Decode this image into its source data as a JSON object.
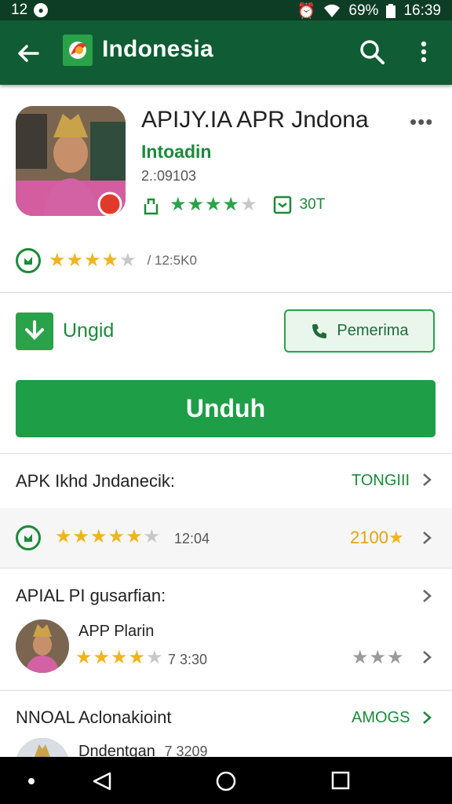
{
  "status": {
    "time_left": "12",
    "battery": "69%",
    "clock": "16:39"
  },
  "appbar": {
    "title": "Indonesia"
  },
  "app": {
    "name": "APIJY.IA APR Jndona",
    "developer": "Intoadin",
    "version": "2.:09103",
    "more": "•••",
    "size_label": "30T",
    "rating_count": "/ 12:5K0"
  },
  "actions": {
    "ungid_label": "Ungid",
    "call_label": "Pemerima",
    "download_label": "Unduh"
  },
  "section1": {
    "title": "APK Ikhd Jndanecik:",
    "link": "TONGIII"
  },
  "rating_band": {
    "count": "12:04",
    "score": "2100"
  },
  "section2": {
    "title": "APIAL PI gusarfian:",
    "item_title": "APP Plarin",
    "item_count": "7 3:30"
  },
  "section3": {
    "title": "NNOAL Aclonakioint",
    "link": "AMOGS",
    "item_title": "Dndentgan",
    "item_count": "7 3209"
  },
  "colors": {
    "brand_dark": "#105c34",
    "accent_green": "#1e9e47",
    "star_yellow": "#f0b41c"
  }
}
